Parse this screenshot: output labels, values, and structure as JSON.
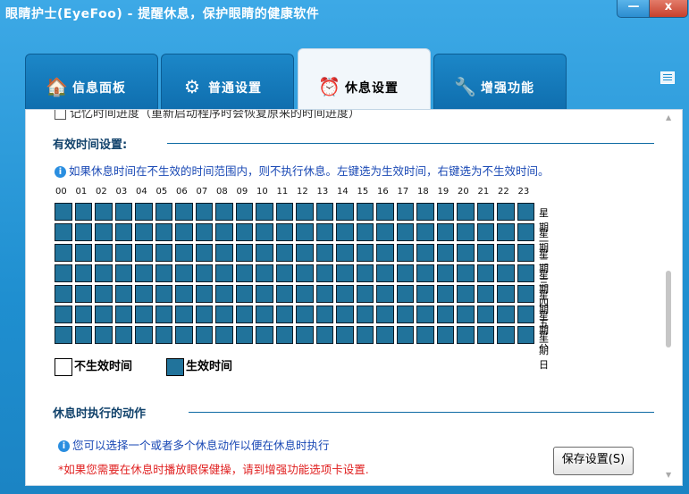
{
  "window": {
    "title": "眼睛护士(EyeFoo) - 提醒休息，保护眼睛的健康软件",
    "minimize_label": "—",
    "close_label": "x"
  },
  "tabs": [
    {
      "label": "信息面板",
      "icon": "house-icon",
      "active": false
    },
    {
      "label": "普通设置",
      "icon": "gears-icon",
      "active": false
    },
    {
      "label": "休息设置",
      "icon": "alarm-clock-icon",
      "active": true
    },
    {
      "label": "增强功能",
      "icon": "multitool-icon",
      "active": false
    }
  ],
  "panel": {
    "top_cut_text": "记忆时间进度（重新启动程序时会恢复原来的时间进度）",
    "effective_section": {
      "title": "有效时间设置:",
      "info": "如果休息时间在不生效的时间范围内，则不执行休息。左键选为生效时间，右键选为不生效时间。",
      "hours": [
        "00",
        "01",
        "02",
        "03",
        "04",
        "05",
        "06",
        "07",
        "08",
        "09",
        "10",
        "11",
        "12",
        "13",
        "14",
        "15",
        "16",
        "17",
        "18",
        "19",
        "20",
        "21",
        "22",
        "23"
      ],
      "days": [
        "星期一",
        "星期二",
        "星期三",
        "星期四",
        "星期五",
        "星期六",
        "星期日"
      ],
      "all_effective": true,
      "legend_inactive": "不生效时间",
      "legend_active": "生效时间",
      "active_color": "#21739b"
    },
    "action_section": {
      "title": "休息时执行的动作",
      "info": "您可以选择一个或者多个休息动作以便在休息时执行",
      "note": "*如果您需要在休息时播放眼保健操，请到增强功能选项卡设置.",
      "note_color": "#e02020"
    },
    "save_button": "保存设置(S)"
  }
}
